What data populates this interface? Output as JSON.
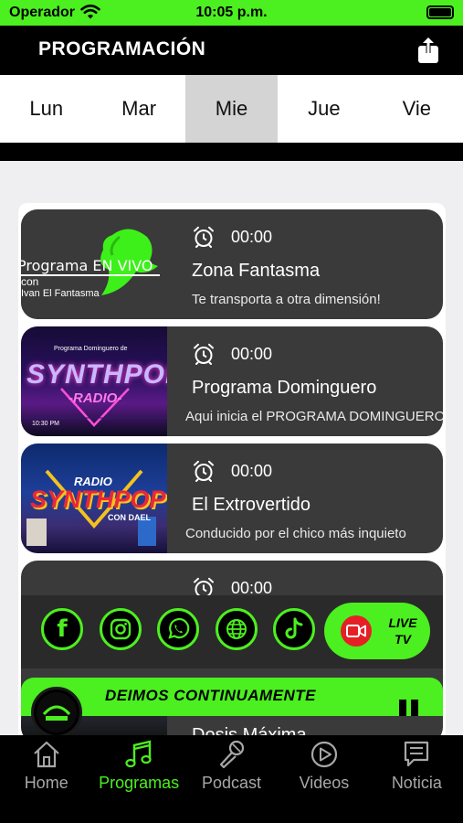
{
  "status_bar": {
    "carrier": "Operador",
    "time": "10:05 p.m."
  },
  "header": {
    "title": "PROGRAMACIÓN",
    "share_icon": "share-icon"
  },
  "days": [
    "Lun",
    "Mar",
    "Mie",
    "Jue",
    "Vie"
  ],
  "active_day": "Mie",
  "programs": [
    {
      "time": "00:00",
      "name": "Zona Fantasma",
      "description": "Te transporta a otra dimensión!",
      "thumb_line1": "Programa EN VIVO",
      "thumb_line2": "con",
      "thumb_line3": "Ivan El Fantasma"
    },
    {
      "time": "00:00",
      "name": "Programa Dominguero",
      "description": "Aqui inicia el PROGRAMA DOMINGUERO",
      "thumb_line1": "Programa Dominguero de",
      "thumb_line2": "SYNTHPOP",
      "thumb_line3": "-RADIO-",
      "thumb_line4": "10:30 PM"
    },
    {
      "time": "00:00",
      "name": "El Extrovertido",
      "description": "Conducido por el chico más inquieto",
      "thumb_line1": "RADIO",
      "thumb_line2": "SYNTHPOP",
      "thumb_line3": "CON DAEL"
    },
    {
      "time": "00:00",
      "name": "Dosis Máxima",
      "description": ""
    }
  ],
  "social": [
    "facebook-icon",
    "instagram-icon",
    "whatsapp-icon",
    "web-icon",
    "tiktok-icon"
  ],
  "live_tv": {
    "line1": "LIVE",
    "line2": "TV"
  },
  "player": {
    "now_playing": "DEIMOS CONTINUAMENTE"
  },
  "tabs": [
    {
      "label": "Home",
      "icon": "home-icon"
    },
    {
      "label": "Programas",
      "icon": "music-note-icon"
    },
    {
      "label": "Podcast",
      "icon": "microphone-icon"
    },
    {
      "label": "Videos",
      "icon": "play-circle-icon"
    },
    {
      "label": "Noticia",
      "icon": "news-icon"
    }
  ],
  "active_tab": "Programas",
  "colors": {
    "accent": "#4cef1f",
    "card": "#3a3a3a",
    "live_red": "#e61f26"
  }
}
